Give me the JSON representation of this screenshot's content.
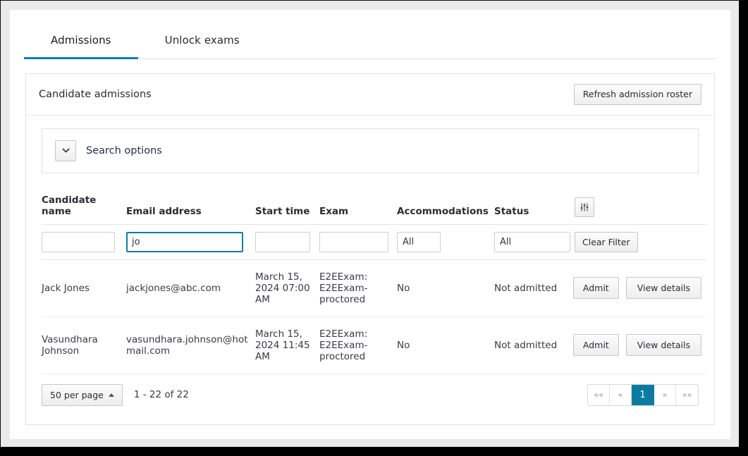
{
  "tabs": [
    {
      "label": "Admissions",
      "active": true
    },
    {
      "label": "Unlock exams",
      "active": false
    }
  ],
  "card": {
    "title": "Candidate admissions",
    "refresh_label": "Refresh admission roster"
  },
  "search_options": {
    "label": "Search options",
    "toggle_icon": "chevron-down-icon",
    "expanded": false
  },
  "table": {
    "columns": [
      "Candidate name",
      "Email address",
      "Start time",
      "Exam",
      "Accommodations",
      "Status",
      ""
    ],
    "column_settings_icon": "sliders-icon",
    "filters": {
      "name_value": "",
      "email_value": "jo",
      "start_time_value": "",
      "exam_value": "",
      "accommodations_value": "All",
      "status_value": "All",
      "clear_label": "Clear Filter"
    },
    "rows": [
      {
        "name": "Jack Jones",
        "email": "jackjones@abc.com",
        "start_time": "March 15, 2024 07:00 AM",
        "exam": "E2EExam: E2EExam-proctored",
        "accommodations": "No",
        "status": "Not admitted",
        "admit_label": "Admit",
        "details_label": "View details"
      },
      {
        "name": "Vasundhara Johnson",
        "email": "vasundhara.johnson@hotmail.com",
        "start_time": "March 15, 2024 11:45 AM",
        "exam": "E2EExam: E2EExam-proctored",
        "accommodations": "No",
        "status": "Not admitted",
        "admit_label": "Admit",
        "details_label": "View details"
      }
    ]
  },
  "footer": {
    "per_page_label": "50 per page",
    "range_text": "1 - 22 of 22",
    "pagination": [
      {
        "label": "««",
        "name": "first",
        "current": false
      },
      {
        "label": "«",
        "name": "prev",
        "current": false
      },
      {
        "label": "1",
        "name": "page-1",
        "current": true
      },
      {
        "label": "»",
        "name": "next",
        "current": false
      },
      {
        "label": "»»",
        "name": "last",
        "current": false
      }
    ]
  },
  "colors": {
    "accent_tab": "#0f7cb5",
    "accent_pager": "#0b7ba1",
    "focus_border": "#0e7c9e",
    "text": "#2b2b33"
  }
}
